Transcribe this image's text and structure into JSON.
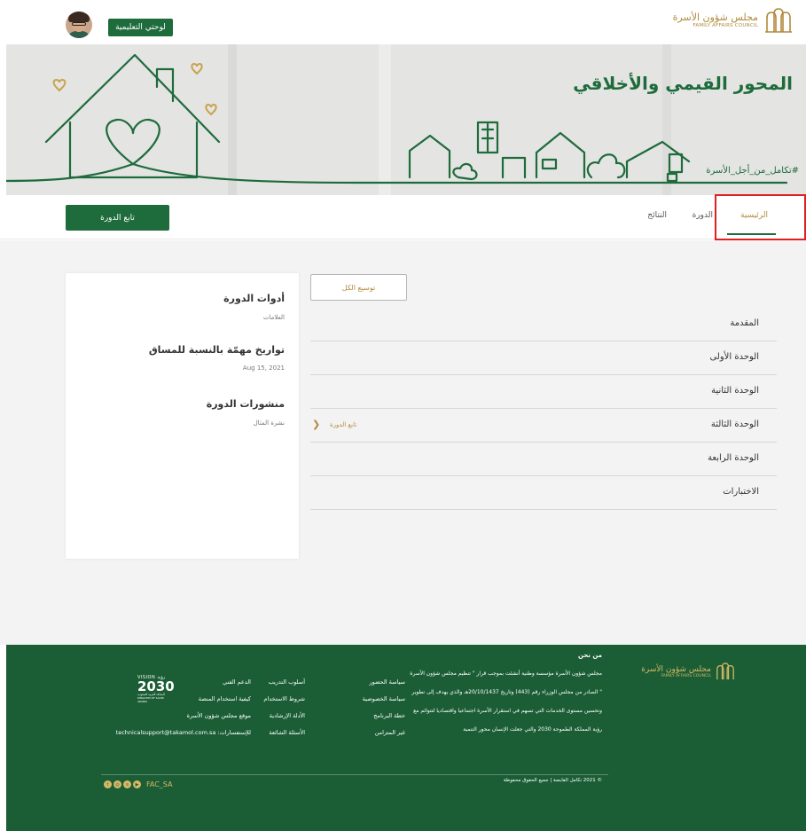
{
  "header": {
    "dashboard_label": "لوحتي التعليمية",
    "logo_ar": "مجلس شؤون الأسرة",
    "logo_en": "FAMILY AFFAIRS COUNCIL"
  },
  "banner": {
    "title": "المحور القيمي والأخلاقي",
    "hashtag": "#تكامل_من_أجل_الأسرة"
  },
  "tabs": {
    "items": [
      {
        "label": "الرئيسية",
        "active": true
      },
      {
        "label": "الدورة",
        "active": false
      },
      {
        "label": "النتائج",
        "active": false
      }
    ],
    "follow_course_label": "تابع الدورة"
  },
  "sidebar_card": {
    "tools_title": "أدوات الدورة",
    "tools_sub": "العلامات",
    "dates_title": "تواريخ مهمّة بالنسبة للمساق",
    "date": "Aug 15, 2021",
    "posts_title": "منشورات الدورة",
    "posts_sub": "نشرة المثال"
  },
  "content": {
    "expand_label": "توسيع الكل",
    "follow_link": "تابع الدورة",
    "units": [
      "المقدمة",
      "الوحدة الأولى",
      "الوحدة الثانية",
      "الوحدة الثالثة",
      "الوحدة الرابعة",
      "الاختبارات"
    ]
  },
  "footer": {
    "about_title": "من نحن",
    "about_text": "مجلس شؤون الأسرة مؤسسة وطنية أنشئت بموجب قرار \" تنظيم مجلس شؤون الأسرة \" الصادر من مجلس الوزراء رقم (443) وتاريخ 20/10/1437هـ والذي يهدف إلى تطوير وتحسين مستوى الخدمات التي تسهم في استقرار الأسرة اجتماعيا واقتصاديا لتتوائم مع رؤية المملكة الطموحة 2030 والتي جعلت الإنسان محور التنمية",
    "col1": [
      "سياسة الحضور",
      "سياسة الخصوصية",
      "خطة البرنامج",
      "غير المتزامن"
    ],
    "col2": [
      "أسلوب التدريب",
      "شروط الاستخدام",
      "الأدلة الإرشادية",
      "الأسئلة الشائعة"
    ],
    "col3": [
      "الدعم الفني",
      "كيفية استخدام المنصة",
      "موقع مجلس شؤون الأسرة",
      "للإستفسارات: technicalsupport@takamol.com.sa"
    ],
    "vision_top": "VISION رؤية",
    "vision_year": "2030",
    "vision_sub": "المملكة العربية السعودية KINGDOM OF SAUDI ARABIA",
    "copyright": "© 2021 تكامل القابضة | جميع الحقوق محفوظة",
    "social_handle": "FAC_SA"
  },
  "colors": {
    "brand_green": "#1e6b3c",
    "footer_green": "#1b5e35",
    "gold": "#b08a3c",
    "highlight_red": "#e01f1f"
  }
}
